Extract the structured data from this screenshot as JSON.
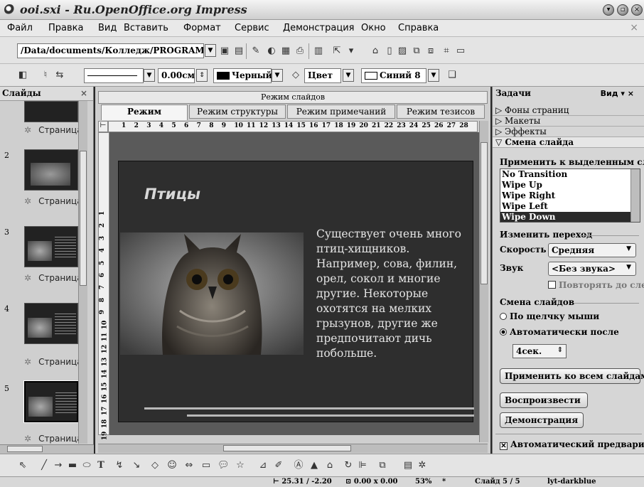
{
  "window": {
    "title": "ooi.sxi - Ru.OpenOffice.org Impress"
  },
  "menu": [
    "Файл",
    "Правка",
    "Вид",
    "Вставить",
    "Формат",
    "Сервис",
    "Демонстрация",
    "Окно",
    "Справка"
  ],
  "toolbar": {
    "load_url": "/Data/documents/Колледж/PROGRAM"
  },
  "line_toolbar": {
    "line_width": "0.00см",
    "line_color": "Черный",
    "area_style": "Цвет",
    "area_color": "Синий 8"
  },
  "slides_panel": {
    "title": "Слайды",
    "items": [
      {
        "num": "",
        "caption": "Страница"
      },
      {
        "num": "2",
        "caption": "Страница"
      },
      {
        "num": "3",
        "caption": "Страница"
      },
      {
        "num": "4",
        "caption": "Страница"
      },
      {
        "num": "5",
        "caption": "Страница"
      }
    ]
  },
  "editor": {
    "mode_header": "Режим слайдов",
    "tabs": [
      "Режим рисования",
      "Режим структуры",
      "Режим примечаний",
      "Режим тезисов"
    ],
    "active_tab": "Режим рисования",
    "ruler_h": [
      "1",
      "2",
      "3",
      "4",
      "5",
      "6",
      "7",
      "8",
      "9",
      "10",
      "11",
      "12",
      "13",
      "14",
      "15",
      "16",
      "17",
      "18",
      "19",
      "20",
      "21",
      "22",
      "23",
      "24",
      "25",
      "26",
      "27",
      "28"
    ],
    "ruler_v": [
      "1",
      "2",
      "3",
      "4",
      "5",
      "6",
      "7",
      "8",
      "9",
      "10",
      "11",
      "12",
      "13",
      "14",
      "15",
      "16",
      "17",
      "18",
      "19",
      "20",
      "21"
    ]
  },
  "slide": {
    "title": "Птицы",
    "body": "Существует очень много птиц-хищников. Например, сова, филин, орел, сокол и многие другие. Некоторые охотятся на мелких грызунов, другие же предпочитают дичь побольше."
  },
  "tasks": {
    "title": "Задачи",
    "view_label": "Вид",
    "sections": [
      "Фоны страниц",
      "Макеты",
      "Эффекты",
      "Смена слайда"
    ],
    "apply_to_selected": "Применить к выделенным сл...",
    "transitions": [
      "No Transition",
      "Wipe Up",
      "Wipe Right",
      "Wipe Left",
      "Wipe Down"
    ],
    "selected_transition": "Wipe Down",
    "modify_heading": "Изменить переход",
    "speed_label": "Скорость",
    "speed_value": "Средняя",
    "sound_label": "Звук",
    "sound_value": "<Без звука>",
    "loop_label": "Повторять до сле",
    "advance_heading": "Смена слайдов",
    "on_click": "По щелчку мыши",
    "auto_after": "Автоматически после",
    "auto_time": "4сек.",
    "apply_all": "Применить ко всем слайдам",
    "play": "Воспроизвести",
    "slideshow": "Демонстрация",
    "auto_preview": "Автоматический предварител"
  },
  "status": {
    "position": "25.31 / -2.20",
    "size": "0.00 x 0.00",
    "zoom": "53%",
    "modified": "*",
    "slide": "Слайд 5 / 5",
    "layout": "lyt-darkblue"
  }
}
